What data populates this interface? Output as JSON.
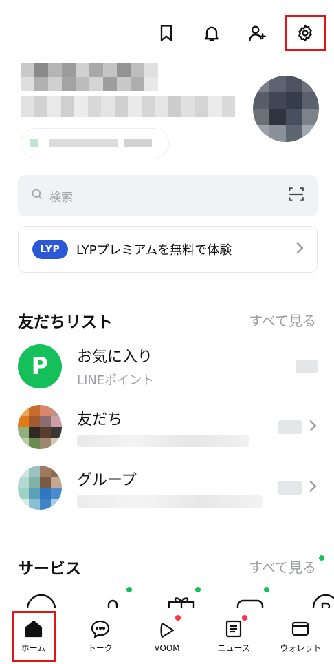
{
  "topbar": {
    "icons": [
      "bookmark-icon",
      "bell-icon",
      "add-friend-icon",
      "settings-icon"
    ],
    "highlight_color": "#e01616"
  },
  "search": {
    "placeholder": "検索"
  },
  "banner": {
    "badge": "LYP",
    "text": "LYPプレミアムを無料で体験",
    "badge_color": "#2b58d6"
  },
  "friends_section": {
    "title": "友だちリスト",
    "more": "すべて見る",
    "rows": [
      {
        "title": "お気に入り",
        "subtitle": "LINEポイント",
        "avatar_letter": "P"
      },
      {
        "title": "友だち"
      },
      {
        "title": "グループ"
      }
    ]
  },
  "services_section": {
    "title": "サービス",
    "more": "すべて見る"
  },
  "bottom_nav": {
    "items": [
      {
        "label": "ホーム",
        "icon": "home-icon"
      },
      {
        "label": "トーク",
        "icon": "chat-icon"
      },
      {
        "label": "VOOM",
        "icon": "voom-icon"
      },
      {
        "label": "ニュース",
        "icon": "news-icon"
      },
      {
        "label": "ウォレット",
        "icon": "wallet-icon"
      }
    ]
  },
  "colors": {
    "accent_green": "#15c05a",
    "notification_red": "#ff334b",
    "muted_text": "#9a9da2"
  }
}
